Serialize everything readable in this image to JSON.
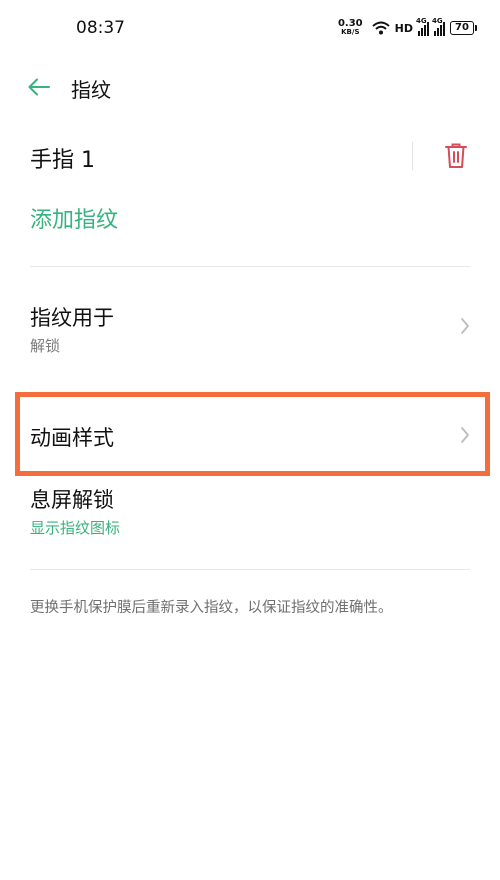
{
  "status_bar": {
    "time": "08:37",
    "net_speed_value": "0.30",
    "net_speed_unit": "KB/S",
    "hd_label": "HD",
    "signal_1_type": "4G",
    "signal_2_type": "4G",
    "battery": "70"
  },
  "app_bar": {
    "title": "指纹"
  },
  "fingerprint": {
    "name": "手指 1",
    "add_label": "添加指纹"
  },
  "menu": [
    {
      "title": "指纹用于",
      "subtitle": "解锁"
    },
    {
      "title": "动画样式"
    },
    {
      "title": "息屏解锁",
      "subtitle": "显示指纹图标"
    }
  ],
  "note": "更换手机保护膜后重新录入指纹，以保证指纹的准确性。",
  "colors": {
    "accent_green": "#36b37e",
    "delete_red": "#d64d5a",
    "highlight_orange": "#f36d3d"
  },
  "icons": {
    "back": "arrow-left-icon",
    "delete": "trash-icon",
    "chevron": "chevron-right-icon",
    "wifi": "wifi-icon"
  }
}
